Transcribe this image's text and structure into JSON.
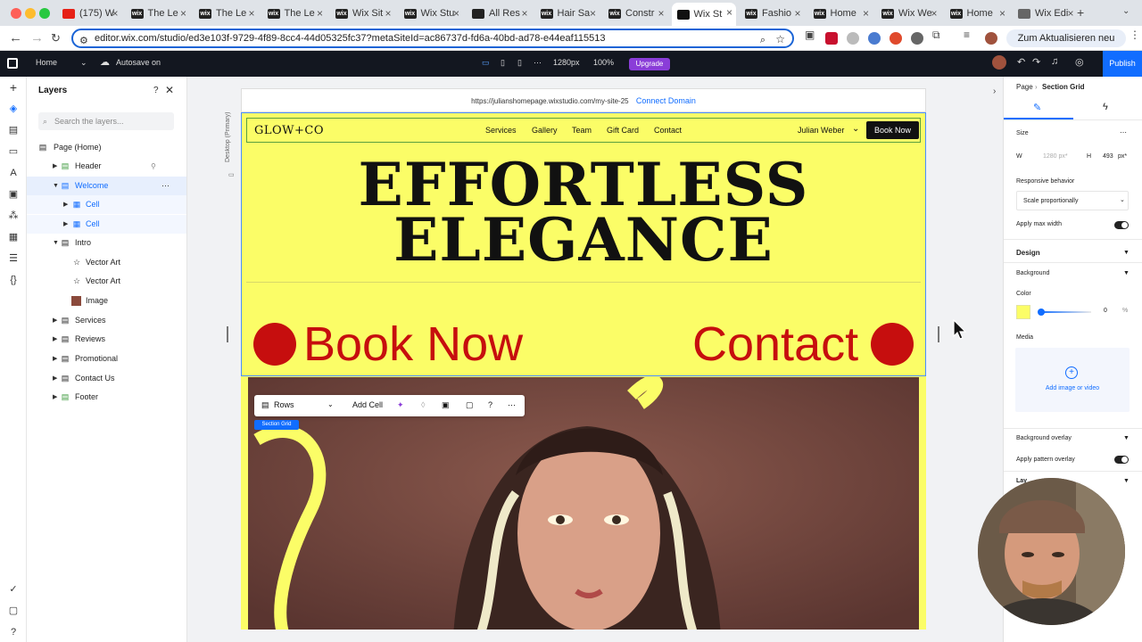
{
  "browser": {
    "tabs": [
      {
        "label": "(175) W",
        "fav_color": "#e62117",
        "fav_text": ""
      },
      {
        "label": "The Le",
        "fav_color": "#222222",
        "fav_text": "wix"
      },
      {
        "label": "The Le",
        "fav_color": "#222222",
        "fav_text": "wix"
      },
      {
        "label": "The Le",
        "fav_color": "#222222",
        "fav_text": "wix"
      },
      {
        "label": "Wix Sit",
        "fav_color": "#222222",
        "fav_text": "wix"
      },
      {
        "label": "Wix Stu",
        "fav_color": "#222222",
        "fav_text": "wix"
      },
      {
        "label": "All Res",
        "fav_color": "#222222",
        "fav_text": ""
      },
      {
        "label": "Hair Sa",
        "fav_color": "#222222",
        "fav_text": "wix"
      },
      {
        "label": "Constr",
        "fav_color": "#222222",
        "fav_text": "wix"
      },
      {
        "label": "Wix St",
        "fav_color": "#111111",
        "fav_text": ""
      },
      {
        "label": "Fashio",
        "fav_color": "#222222",
        "fav_text": "wix"
      },
      {
        "label": "Home",
        "fav_color": "#222222",
        "fav_text": "wix"
      },
      {
        "label": "Wix We",
        "fav_color": "#222222",
        "fav_text": "wix"
      },
      {
        "label": "Home",
        "fav_color": "#222222",
        "fav_text": "wix"
      },
      {
        "label": "Wix Edi",
        "fav_color": "#666666",
        "fav_text": ""
      }
    ],
    "active_tab_index": 9,
    "url": "editor.wix.com/studio/ed3e103f-9729-4f89-8cc4-44d05325fc37?metaSiteId=ac86737d-fd6a-40bd-ad78-e44eaf115513",
    "update_button": "Zum Aktualisieren neu starten"
  },
  "wix_bar": {
    "page_select": "Home",
    "autosave": "Autosave on",
    "breakpoint": "1280px",
    "zoom": "100%",
    "upgrade": "Upgrade",
    "publish": "Publish"
  },
  "layers": {
    "title": "Layers",
    "search_placeholder": "Search the layers...",
    "items": [
      {
        "label": "Page (Home)"
      },
      {
        "label": "Header"
      },
      {
        "label": "Welcome"
      },
      {
        "label": "Cell"
      },
      {
        "label": "Cell"
      },
      {
        "label": "Intro"
      },
      {
        "label": "Vector Art"
      },
      {
        "label": "Vector Art"
      },
      {
        "label": "Image"
      },
      {
        "label": "Services"
      },
      {
        "label": "Reviews"
      },
      {
        "label": "Promotional"
      },
      {
        "label": "Contact Us"
      },
      {
        "label": "Footer"
      }
    ]
  },
  "canvas": {
    "site_url": "https://julianshomepage.wixstudio.com/my-site-25",
    "connect_domain": "Connect Domain",
    "breakpoint_label": "Desktop (Primary)",
    "site": {
      "logo": "GLOW+CO",
      "nav": [
        "Services",
        "Gallery",
        "Team",
        "Gift Card",
        "Contact"
      ],
      "user": "Julian Weber",
      "book_button": "Book Now",
      "headline_1": "EFFORTLESS",
      "headline_2": "ELEGANCE",
      "cta_left": "Book Now",
      "cta_right": "Contact"
    },
    "toolbar": {
      "rows": "Rows",
      "add_cell": "Add Cell"
    },
    "section_tag": "Section Grid"
  },
  "inspector": {
    "breadcrumb_page": "Page",
    "breadcrumb_current": "Section Grid",
    "size_label": "Size",
    "w_label": "W",
    "w_value": "1280 px*",
    "h_label": "H",
    "h_value": "493",
    "h_unit": "px*",
    "responsive_label": "Responsive behavior",
    "responsive_value": "Scale proportionally",
    "apply_max_width": "Apply max width",
    "design": "Design",
    "background": "Background",
    "color": "Color",
    "color_hex": "#fbfd67",
    "opacity_value": "0",
    "opacity_unit": "%",
    "media": "Media",
    "add_media": "Add image or video",
    "bg_overlay": "Background overlay",
    "pattern_overlay": "Apply pattern overlay",
    "layers_partial": "Lay"
  },
  "colors": {
    "accent": "#116dff",
    "site_yellow": "#fbfd67",
    "cta_red": "#c60e0e",
    "upgrade_purple": "#8a3dd8"
  }
}
